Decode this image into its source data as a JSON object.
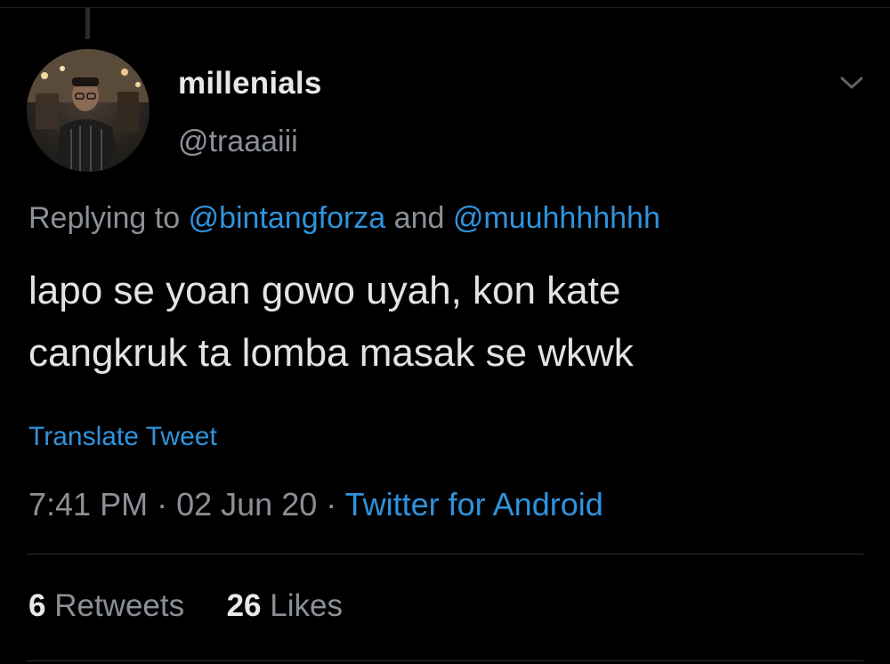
{
  "tweet": {
    "author": {
      "display_name": "millenials",
      "handle": "@traaaiii"
    },
    "replying_prefix": "Replying to",
    "replying_to": [
      "@bintangforza",
      "@muuhhhhhhh"
    ],
    "replying_and": "and",
    "text_line1": "lapo se yoan gowo uyah, kon kate",
    "text_line2": "cangkruk ta lomba masak se wkwk",
    "translate_label": "Translate Tweet",
    "time": "7:41 PM",
    "date": "02 Jun 20",
    "separator": "·",
    "source": "Twitter for Android",
    "stats": {
      "retweets_count": "6",
      "retweets_label": "Retweets",
      "likes_count": "26",
      "likes_label": "Likes"
    }
  },
  "icons": {
    "more_menu": "chevron-down-icon"
  },
  "colors": {
    "background": "#000000",
    "link": "#2f93dd",
    "muted": "#8b9097",
    "text": "#e3e3e3"
  }
}
